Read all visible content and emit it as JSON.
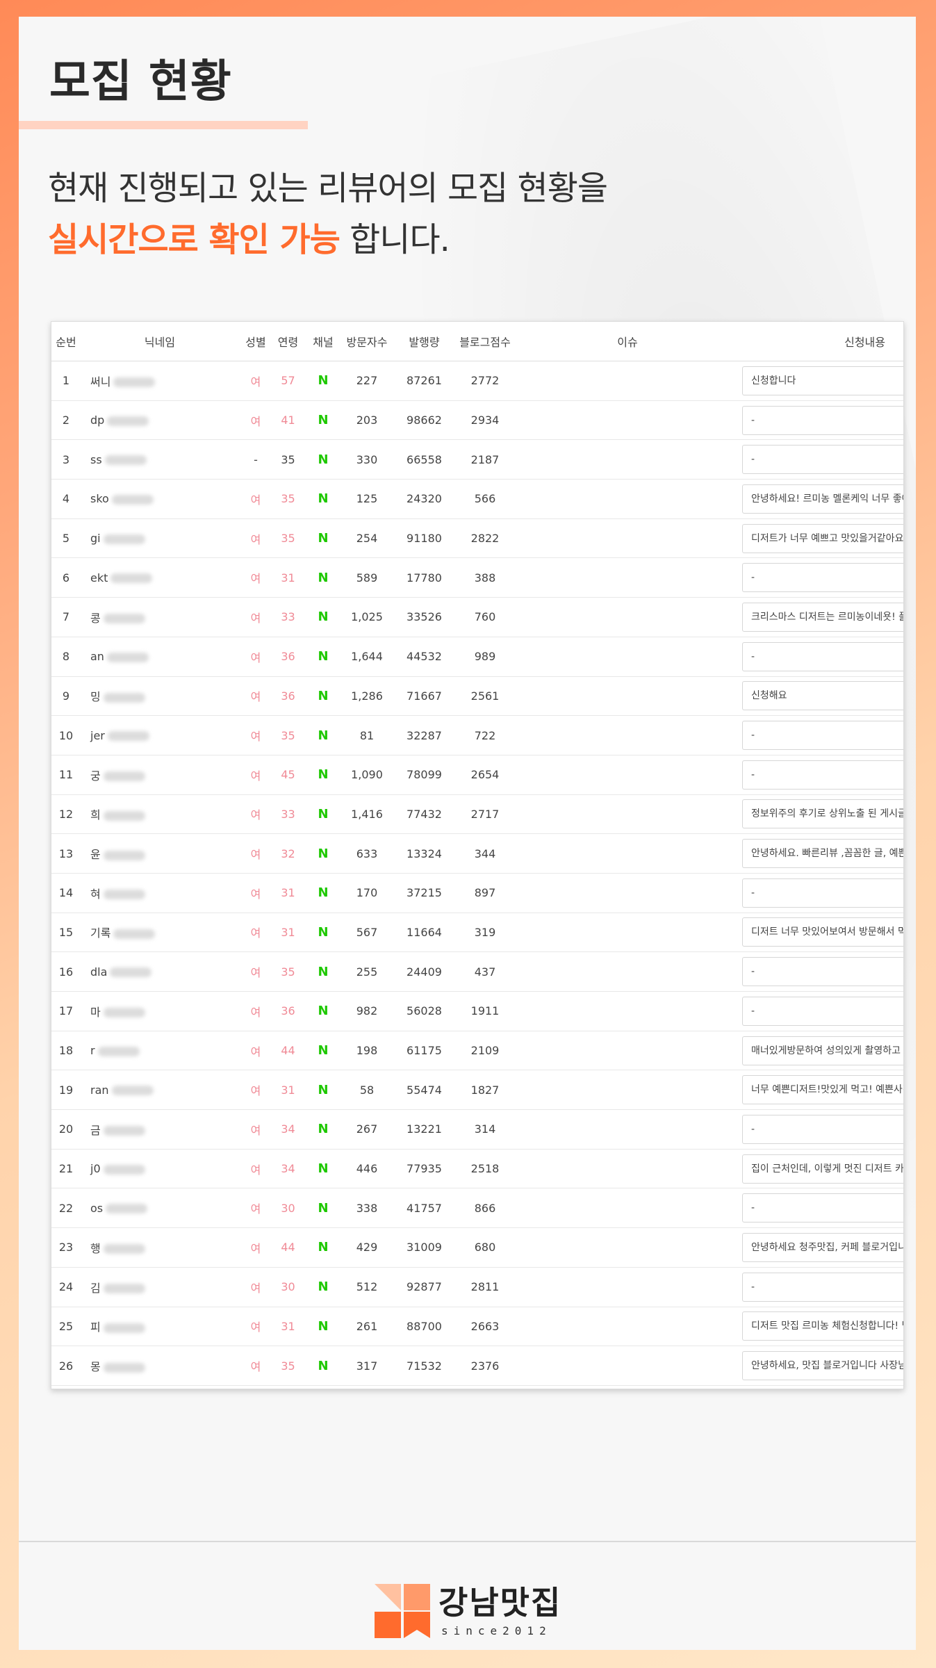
{
  "page": {
    "heading": "모집 현황",
    "intro_line1": "현재 진행되고 있는 리뷰어의 모집 현황을",
    "intro_highlight": "실시간으로 확인 가능",
    "intro_suffix": " 합니다."
  },
  "table": {
    "columns": [
      "순번",
      "닉네임",
      "성별",
      "연령",
      "채널",
      "방문자수",
      "발행량",
      "블로그점수",
      "이슈",
      "신청내용"
    ],
    "channel_symbol": "N",
    "rows": [
      {
        "no": "1",
        "nick": "써니",
        "gender": "여",
        "age": "57",
        "visitors": "227",
        "posts": "87261",
        "score": "2772",
        "issue": "",
        "apply": "신청합니다"
      },
      {
        "no": "2",
        "nick": "dp",
        "gender": "여",
        "age": "41",
        "visitors": "203",
        "posts": "98662",
        "score": "2934",
        "issue": "",
        "apply": "-"
      },
      {
        "no": "3",
        "nick": "ss",
        "gender": "-",
        "age": "35",
        "visitors": "330",
        "posts": "66558",
        "score": "2187",
        "issue": "",
        "apply": "-"
      },
      {
        "no": "4",
        "nick": "sko",
        "gender": "여",
        "age": "35",
        "visitors": "125",
        "posts": "24320",
        "score": "566",
        "issue": "",
        "apply": "안녕하세요! 르미농 멜론케익 너무 좋아하"
      },
      {
        "no": "5",
        "nick": "gi",
        "gender": "여",
        "age": "35",
        "visitors": "254",
        "posts": "91180",
        "score": "2822",
        "issue": "",
        "apply": "디저트가 너무 예쁘고 맛있을거같아요! 디"
      },
      {
        "no": "6",
        "nick": "ekt",
        "gender": "여",
        "age": "31",
        "visitors": "589",
        "posts": "17780",
        "score": "388",
        "issue": "",
        "apply": "-"
      },
      {
        "no": "7",
        "nick": "콩",
        "gender": "여",
        "age": "33",
        "visitors": "1,025",
        "posts": "33526",
        "score": "760",
        "issue": "",
        "apply": "크리스마스 디저트는 르미농이네욧! 플레"
      },
      {
        "no": "8",
        "nick": "an",
        "gender": "여",
        "age": "36",
        "visitors": "1,644",
        "posts": "44532",
        "score": "989",
        "issue": "",
        "apply": "-"
      },
      {
        "no": "9",
        "nick": "밍",
        "gender": "여",
        "age": "36",
        "visitors": "1,286",
        "posts": "71667",
        "score": "2561",
        "issue": "",
        "apply": "신청해요"
      },
      {
        "no": "10",
        "nick": "jer",
        "gender": "여",
        "age": "35",
        "visitors": "81",
        "posts": "32287",
        "score": "722",
        "issue": "",
        "apply": "-"
      },
      {
        "no": "11",
        "nick": "궁",
        "gender": "여",
        "age": "45",
        "visitors": "1,090",
        "posts": "78099",
        "score": "2654",
        "issue": "",
        "apply": "-"
      },
      {
        "no": "12",
        "nick": "희",
        "gender": "여",
        "age": "33",
        "visitors": "1,416",
        "posts": "77432",
        "score": "2717",
        "issue": "",
        "apply": "정보위주의 후기로 상위노출 된 게시글이"
      },
      {
        "no": "13",
        "nick": "윤",
        "gender": "여",
        "age": "32",
        "visitors": "633",
        "posts": "13324",
        "score": "344",
        "issue": "",
        "apply": "안녕하세요. 빠른리뷰 ,꼼꼼한 글, 예쁜사진"
      },
      {
        "no": "14",
        "nick": "혀",
        "gender": "여",
        "age": "31",
        "visitors": "170",
        "posts": "37215",
        "score": "897",
        "issue": "",
        "apply": "-"
      },
      {
        "no": "15",
        "nick": "기록",
        "gender": "여",
        "age": "31",
        "visitors": "567",
        "posts": "11664",
        "score": "319",
        "issue": "",
        "apply": "디저트 너무 맛있어보여서 방문해서 먹어"
      },
      {
        "no": "16",
        "nick": "dla",
        "gender": "여",
        "age": "35",
        "visitors": "255",
        "posts": "24409",
        "score": "437",
        "issue": "",
        "apply": "-"
      },
      {
        "no": "17",
        "nick": "마",
        "gender": "여",
        "age": "36",
        "visitors": "982",
        "posts": "56028",
        "score": "1911",
        "issue": "",
        "apply": "-"
      },
      {
        "no": "18",
        "nick": "r",
        "gender": "여",
        "age": "44",
        "visitors": "198",
        "posts": "61175",
        "score": "2109",
        "issue": "",
        "apply": "매너있게방문하여 성의있게 촬영하고 정성"
      },
      {
        "no": "19",
        "nick": "ran",
        "gender": "여",
        "age": "31",
        "visitors": "58",
        "posts": "55474",
        "score": "1827",
        "issue": "",
        "apply": "너무 예쁜디저트!맛있게 먹고! 예쁜사진! 꼼"
      },
      {
        "no": "20",
        "nick": "금",
        "gender": "여",
        "age": "34",
        "visitors": "267",
        "posts": "13221",
        "score": "314",
        "issue": "",
        "apply": "-"
      },
      {
        "no": "21",
        "nick": "j0",
        "gender": "여",
        "age": "34",
        "visitors": "446",
        "posts": "77935",
        "score": "2518",
        "issue": "",
        "apply": "집이 근처인데, 이렇게 멋진 디저트 카페가"
      },
      {
        "no": "22",
        "nick": "os",
        "gender": "여",
        "age": "30",
        "visitors": "338",
        "posts": "41757",
        "score": "866",
        "issue": "",
        "apply": "-"
      },
      {
        "no": "23",
        "nick": "행",
        "gender": "여",
        "age": "44",
        "visitors": "429",
        "posts": "31009",
        "score": "680",
        "issue": "",
        "apply": "안녕하세요 청주맛집, 커페 블로거입니다"
      },
      {
        "no": "24",
        "nick": "김",
        "gender": "여",
        "age": "30",
        "visitors": "512",
        "posts": "92877",
        "score": "2811",
        "issue": "",
        "apply": "-"
      },
      {
        "no": "25",
        "nick": "피",
        "gender": "여",
        "age": "31",
        "visitors": "261",
        "posts": "88700",
        "score": "2663",
        "issue": "",
        "apply": "디저트 맛집 르미농 체험신청합니다! 먹음"
      },
      {
        "no": "26",
        "nick": "몽",
        "gender": "여",
        "age": "35",
        "visitors": "317",
        "posts": "71532",
        "score": "2376",
        "issue": "",
        "apply": "안녕하세요, 맛집 블로거입니다 사장님의"
      }
    ]
  },
  "footer": {
    "logo_text": "강남맛집",
    "logo_sub": "since2012"
  },
  "colors": {
    "accent": "#ff6b2d",
    "female": "#f08a96",
    "naver": "#1ec800"
  }
}
